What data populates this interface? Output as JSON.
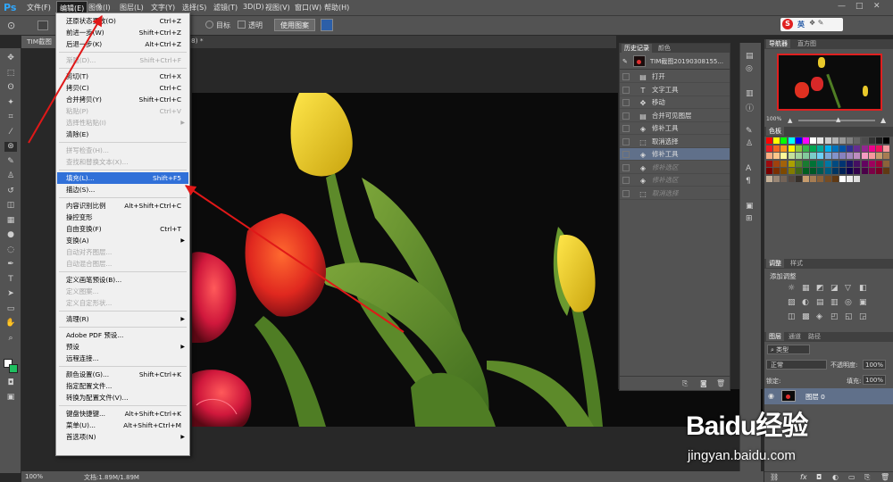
{
  "menubar": {
    "app_logo": "Ps",
    "items": [
      "文件(F)",
      "编辑(E)",
      "图像(I)",
      "图层(L)",
      "文字(Y)",
      "选择(S)",
      "滤镜(T)",
      "3D(D)",
      "视图(V)",
      "窗口(W)",
      "帮助(H)"
    ]
  },
  "options_bar": {
    "target_label": "目标",
    "transparent_label": "透明",
    "use_pattern_button": "使用图案"
  },
  "doc_tab": {
    "title": "TIM截图",
    "suffix": "8) *"
  },
  "edit_menu": {
    "items": [
      {
        "label": "还原状态更改(O)",
        "shortcut": "Ctrl+Z",
        "disabled": false
      },
      {
        "label": "前进一步(W)",
        "shortcut": "Shift+Ctrl+Z",
        "disabled": false
      },
      {
        "label": "后退一步(K)",
        "shortcut": "Alt+Ctrl+Z",
        "disabled": false
      },
      {
        "sep": true
      },
      {
        "label": "渐隐(D)...",
        "shortcut": "Shift+Ctrl+F",
        "disabled": true
      },
      {
        "sep": true
      },
      {
        "label": "剪切(T)",
        "shortcut": "Ctrl+X",
        "disabled": false
      },
      {
        "label": "拷贝(C)",
        "shortcut": "Ctrl+C",
        "disabled": false
      },
      {
        "label": "合并拷贝(Y)",
        "shortcut": "Shift+Ctrl+C",
        "disabled": false
      },
      {
        "label": "粘贴(P)",
        "shortcut": "Ctrl+V",
        "disabled": true
      },
      {
        "label": "选择性粘贴(I)",
        "shortcut": "",
        "disabled": true,
        "submenu": true
      },
      {
        "label": "清除(E)",
        "shortcut": "",
        "disabled": false
      },
      {
        "sep": true
      },
      {
        "label": "拼写检查(H)...",
        "shortcut": "",
        "disabled": true
      },
      {
        "label": "查找和替换文本(X)...",
        "shortcut": "",
        "disabled": true
      },
      {
        "sep": true
      },
      {
        "label": "填充(L)...",
        "shortcut": "Shift+F5",
        "disabled": false,
        "highlighted": true
      },
      {
        "label": "描边(S)...",
        "shortcut": "",
        "disabled": false
      },
      {
        "sep": true
      },
      {
        "label": "内容识别比例",
        "shortcut": "Alt+Shift+Ctrl+C",
        "disabled": false
      },
      {
        "label": "操控变形",
        "shortcut": "",
        "disabled": false
      },
      {
        "label": "自由变换(F)",
        "shortcut": "Ctrl+T",
        "disabled": false
      },
      {
        "label": "变换(A)",
        "shortcut": "",
        "disabled": false,
        "submenu": true
      },
      {
        "label": "自动对齐图层...",
        "shortcut": "",
        "disabled": true
      },
      {
        "label": "自动混合图层...",
        "shortcut": "",
        "disabled": true
      },
      {
        "sep": true
      },
      {
        "label": "定义画笔预设(B)...",
        "shortcut": "",
        "disabled": false
      },
      {
        "label": "定义图案...",
        "shortcut": "",
        "disabled": true
      },
      {
        "label": "定义自定形状...",
        "shortcut": "",
        "disabled": true
      },
      {
        "sep": true
      },
      {
        "label": "清理(R)",
        "shortcut": "",
        "disabled": false,
        "submenu": true
      },
      {
        "sep": true
      },
      {
        "label": "Adobe PDF 预设...",
        "shortcut": "",
        "disabled": false
      },
      {
        "label": "预设",
        "shortcut": "",
        "disabled": false,
        "submenu": true
      },
      {
        "label": "远程连接...",
        "shortcut": "",
        "disabled": false
      },
      {
        "sep": true
      },
      {
        "label": "颜色设置(G)...",
        "shortcut": "Shift+Ctrl+K",
        "disabled": false
      },
      {
        "label": "指定配置文件...",
        "shortcut": "",
        "disabled": false
      },
      {
        "label": "转换为配置文件(V)...",
        "shortcut": "",
        "disabled": false
      },
      {
        "sep": true
      },
      {
        "label": "键盘快捷键...",
        "shortcut": "Alt+Shift+Ctrl+K",
        "disabled": false
      },
      {
        "label": "菜单(U)...",
        "shortcut": "Alt+Shift+Ctrl+M",
        "disabled": false
      },
      {
        "label": "首选项(N)",
        "shortcut": "",
        "disabled": false,
        "submenu": true
      }
    ]
  },
  "history_panel": {
    "tabs": [
      "历史记录",
      "颜色"
    ],
    "snapshot": "TIM截图20190308155...",
    "states": [
      {
        "label": "打开",
        "icon": "open-icon",
        "state": "normal"
      },
      {
        "label": "文字工具",
        "icon": "type-icon",
        "state": "normal"
      },
      {
        "label": "移动",
        "icon": "move-icon",
        "state": "normal"
      },
      {
        "label": "合并可见图层",
        "icon": "merge-icon",
        "state": "normal"
      },
      {
        "label": "修补工具",
        "icon": "patch-icon",
        "state": "normal"
      },
      {
        "label": "取消选择",
        "icon": "deselect-icon",
        "state": "normal"
      },
      {
        "label": "修补工具",
        "icon": "patch-icon",
        "state": "selected"
      },
      {
        "label": "修补选区",
        "icon": "patch-icon",
        "state": "undone"
      },
      {
        "label": "修补选区",
        "icon": "patch-icon",
        "state": "undone"
      },
      {
        "label": "取消选择",
        "icon": "deselect-icon",
        "state": "undone"
      }
    ]
  },
  "right_panel": {
    "navigator_tabs": [
      "导航器",
      "直方图"
    ],
    "swatches_tab": "色板",
    "adjust_tabs": [
      "调整",
      "样式"
    ],
    "add_adjustment": "添加调整",
    "layers_tabs": [
      "图层",
      "通道",
      "路径"
    ],
    "kind_filter": "类型",
    "blend_mode": "正常",
    "opacity_label": "不透明度:",
    "opacity_value": "100%",
    "lock_label": "锁定:",
    "fill_label": "填充:",
    "fill_value": "100%",
    "layer_name": "图层 0"
  },
  "status": {
    "zoom": "100%",
    "doc_size": "文档:1.89M/1.89M"
  },
  "ime": {
    "label": "英"
  },
  "watermark": {
    "brand": "Baidu经验",
    "url": "jingyan.baidu.com"
  }
}
